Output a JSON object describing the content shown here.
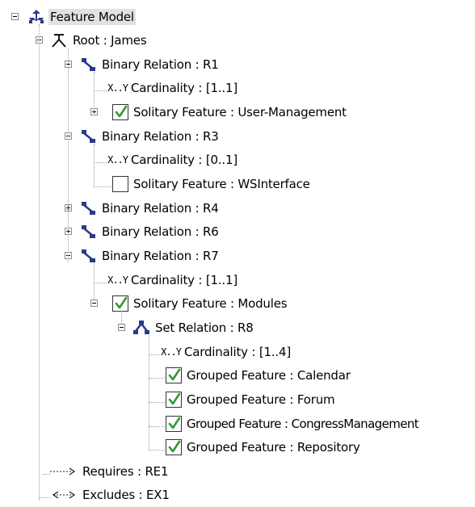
{
  "tree": {
    "nodes": [
      {
        "id": "feature-model",
        "label": "Feature Model",
        "icon": "feature-model-icon",
        "state": "expanded",
        "selected": true
      },
      {
        "id": "root",
        "label": "Root : James",
        "icon": "root-icon",
        "state": "expanded"
      },
      {
        "id": "r1",
        "label": "Binary Relation : R1",
        "icon": "binary-relation-icon",
        "state": "expanded"
      },
      {
        "id": "r1-card",
        "label": "Cardinality : [1..1]",
        "icon": "cardinality-icon",
        "icon_text": "X..Y"
      },
      {
        "id": "r1-feature",
        "label": "Solitary Feature : User-Management",
        "icon": "checkbox-checked-icon",
        "checked": true,
        "state": "collapsed"
      },
      {
        "id": "r3",
        "label": "Binary Relation : R3",
        "icon": "binary-relation-icon",
        "state": "expanded"
      },
      {
        "id": "r3-card",
        "label": "Cardinality : [0..1]",
        "icon": "cardinality-icon",
        "icon_text": "X..Y"
      },
      {
        "id": "r3-feature",
        "label": "Solitary Feature : WSInterface",
        "icon": "checkbox-unchecked-icon",
        "checked": false
      },
      {
        "id": "r4",
        "label": "Binary Relation : R4",
        "icon": "binary-relation-icon",
        "state": "collapsed"
      },
      {
        "id": "r6",
        "label": "Binary Relation : R6",
        "icon": "binary-relation-icon",
        "state": "collapsed"
      },
      {
        "id": "r7",
        "label": "Binary Relation : R7",
        "icon": "binary-relation-icon",
        "state": "expanded"
      },
      {
        "id": "r7-card",
        "label": "Cardinality : [1..1]",
        "icon": "cardinality-icon",
        "icon_text": "X..Y"
      },
      {
        "id": "modules",
        "label": "Solitary Feature : Modules",
        "icon": "checkbox-checked-icon",
        "checked": true,
        "state": "expanded"
      },
      {
        "id": "r8",
        "label": "Set Relation : R8",
        "icon": "set-relation-icon",
        "state": "expanded"
      },
      {
        "id": "r8-card",
        "label": "Cardinality : [1..4]",
        "icon": "cardinality-icon",
        "icon_text": "X..Y"
      },
      {
        "id": "calendar",
        "label": "Grouped Feature : Calendar",
        "icon": "checkbox-checked-icon",
        "checked": true
      },
      {
        "id": "forum",
        "label": "Grouped Feature : Forum",
        "icon": "checkbox-checked-icon",
        "checked": true
      },
      {
        "id": "congress",
        "label": "Grouped Feature : CongressManagement",
        "icon": "checkbox-checked-icon",
        "checked": true
      },
      {
        "id": "repository",
        "label": "Grouped Feature : Repository",
        "icon": "checkbox-checked-icon",
        "checked": true
      },
      {
        "id": "requires",
        "label": "Requires : RE1",
        "icon": "requires-arrow-icon"
      },
      {
        "id": "excludes",
        "label": "Excludes : EX1",
        "icon": "excludes-arrow-icon"
      }
    ]
  },
  "colors": {
    "tree_line": "#a0a0a0",
    "check_green": "#2e9a2e",
    "relation_blue": "#2a3a8a",
    "selection_bg": "#e1e1e1"
  }
}
